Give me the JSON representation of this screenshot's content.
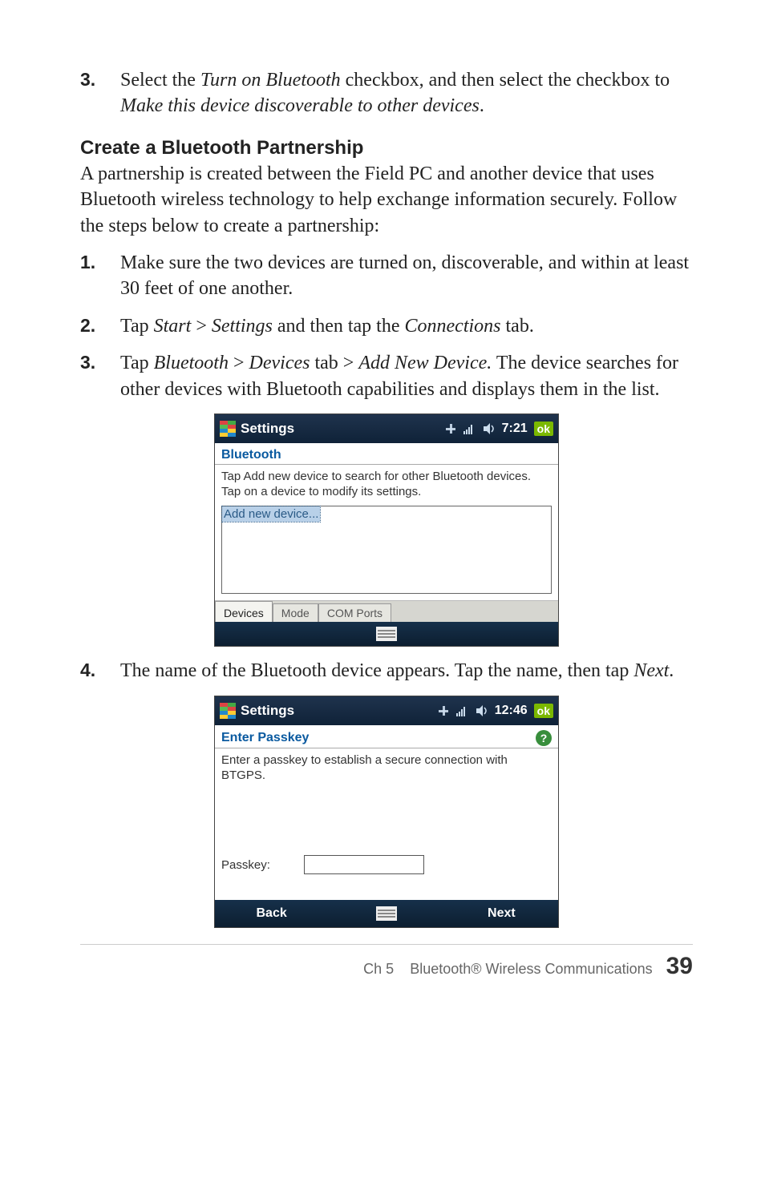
{
  "steps_top": {
    "3": {
      "num": "3.",
      "prefix": "Select the ",
      "em1": "Turn on Bluetooth",
      "mid": " checkbox, and then select the checkbox to ",
      "em2": "Make this device discoverable to other devices",
      "suffix": "."
    }
  },
  "heading": "Create a Bluetooth Partnership",
  "intro": "A partnership is created between the Field PC and another device that uses Bluetooth wireless technology to help exchange information securely. Follow the steps below to create a partnership:",
  "steps_main": {
    "1": {
      "num": "1.",
      "text": "Make sure the two devices are turned on, discoverable, and within at least 30 feet of one another."
    },
    "2": {
      "num": "2.",
      "pre": "Tap ",
      "em1": "Start",
      "mid1": " > ",
      "em2": "Settings",
      "mid2": " and then tap the ",
      "em3": "Connections",
      "post": " tab."
    },
    "3": {
      "num": "3.",
      "pre": "Tap ",
      "em1": "Bluetooth",
      "mid1": " > ",
      "em2": "Devices",
      "mid2": " tab > ",
      "em3": "Add New Device.",
      "post": " The device searches for other devices with Bluetooth capabilities and displays them in the list."
    },
    "4": {
      "num": "4.",
      "pre": "The name of the Bluetooth device appears. Tap the name, then tap ",
      "em1": "Next",
      "post": "."
    }
  },
  "shot1": {
    "title": "Settings",
    "time": "7:21",
    "ok": "ok",
    "header": "Bluetooth",
    "body": "Tap Add new device to search for other Bluetooth devices. Tap on a device to modify its settings.",
    "list_item": "Add new device...",
    "tabs": {
      "devices": "Devices",
      "mode": "Mode",
      "com": "COM Ports"
    }
  },
  "shot2": {
    "title": "Settings",
    "time": "12:46",
    "ok": "ok",
    "header": "Enter Passkey",
    "help": "?",
    "body": "Enter a passkey to establish a secure connection with BTGPS.",
    "passkey_label": "Passkey:",
    "passkey_value": "",
    "back": "Back",
    "next": "Next"
  },
  "footer": {
    "chapter": "Ch 5",
    "title": "Bluetooth® Wireless Communications",
    "page": "39"
  }
}
